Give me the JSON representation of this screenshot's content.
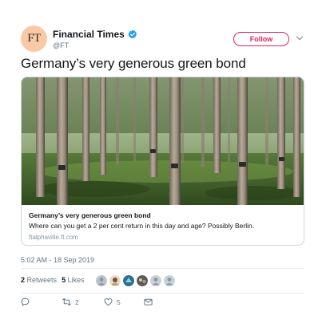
{
  "account": {
    "avatar_text": "FT",
    "display_name": "Financial Times",
    "handle": "@FT",
    "verified": true
  },
  "follow_label": "Follow",
  "tweet_text": "Germany’s very generous green bond",
  "card": {
    "title": "Germany’s very generous green bond",
    "description": "Where can you get a 2 per cent return in this day and age? Possibly Berlin.",
    "domain": "ftalphaville.ft.com",
    "image_subject": "rubber-tree-forest"
  },
  "timestamp": "5:02 AM - 18 Sep 2019",
  "stats": {
    "retweets_count": "2",
    "retweets_label": "Retweets",
    "likes_count": "5",
    "likes_label": "Likes"
  },
  "actions": {
    "reply_count": "",
    "retweet_count": "2",
    "like_count": "5"
  },
  "colors": {
    "brand_pink": "#e0245e",
    "verified_blue": "#1da1f2",
    "muted_text": "#657786",
    "avatar_bg": "#f8c9a4"
  }
}
